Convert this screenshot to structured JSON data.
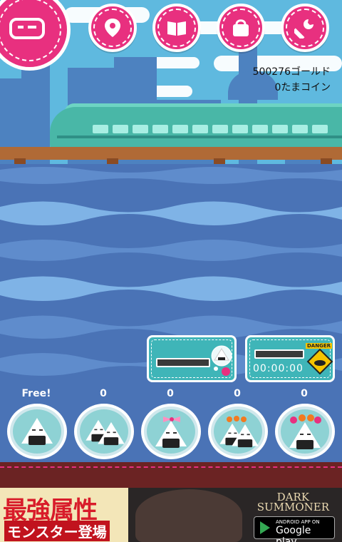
{
  "hud": {
    "gold": "500276ゴールド",
    "coins": "0たまコイン"
  },
  "menu": [
    {
      "name": "gear-menu-button",
      "icon": "gear-icon"
    },
    {
      "name": "map-pin-button",
      "icon": "map-pin-icon"
    },
    {
      "name": "book-button",
      "icon": "book-icon"
    },
    {
      "name": "bag-button",
      "icon": "bag-icon"
    },
    {
      "name": "wrench-button",
      "icon": "wrench-icon"
    }
  ],
  "panels": {
    "left": {
      "icon": "onigiri-bubble-icon"
    },
    "right": {
      "timer": "00:00:00",
      "danger": "DANGER"
    }
  },
  "slots": [
    {
      "count": "Free!",
      "icon": "onigiri-single-icon"
    },
    {
      "count": "0",
      "icon": "onigiri-double-icon"
    },
    {
      "count": "0",
      "icon": "onigiri-bow-icon"
    },
    {
      "count": "0",
      "icon": "onigiri-salmon-roe-icon"
    },
    {
      "count": "0",
      "icon": "onigiri-ikura-crown-icon"
    }
  ],
  "ad": {
    "headline": "最強属性",
    "subline": "モンスター登場",
    "brand_line1": "DARK",
    "brand_line2": "SUMMONER",
    "store_small": "ANDROID APP ON",
    "store_big": "Google play"
  },
  "colors": {
    "accent": "#e8307f",
    "panel": "#3fb5b8",
    "water": "#4a73b6"
  }
}
